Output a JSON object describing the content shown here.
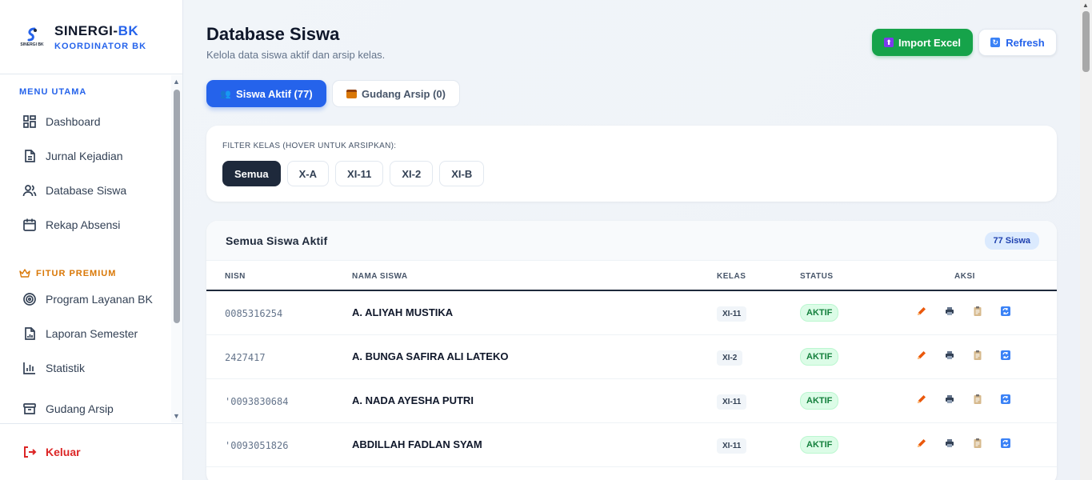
{
  "brand": {
    "name_main": "SINERGI-",
    "name_accent": "BK",
    "subtitle": "KOORDINATOR BK",
    "logo_text": "SINERGI BK"
  },
  "sidebar": {
    "menu_title": "MENU UTAMA",
    "menu_items": [
      {
        "label": "Dashboard",
        "icon": "dashboard-icon"
      },
      {
        "label": "Jurnal Kejadian",
        "icon": "document-icon"
      },
      {
        "label": "Database Siswa",
        "icon": "users-icon"
      },
      {
        "label": "Rekap Absensi",
        "icon": "calendar-icon"
      }
    ],
    "premium_title": "FITUR PREMIUM",
    "premium_items": [
      {
        "label": "Program Layanan BK",
        "icon": "target-icon"
      },
      {
        "label": "Laporan Semester",
        "icon": "report-icon"
      },
      {
        "label": "Statistik",
        "icon": "chart-icon"
      },
      {
        "label": "Gudang Arsip",
        "icon": "archive-icon"
      }
    ],
    "logout_label": "Keluar"
  },
  "header": {
    "title": "Database Siswa",
    "subtitle": "Kelola data siswa aktif dan arsip kelas.",
    "import_label": "Import Excel",
    "refresh_label": "Refresh"
  },
  "tabs": {
    "active_label": "Siswa Aktif (77)",
    "archive_label": "Gudang Arsip (0)"
  },
  "filter": {
    "label": "FILTER KELAS (HOVER UNTUK ARSIPKAN):",
    "chips": [
      "Semua",
      "X-A",
      "XI-11",
      "XI-2",
      "XI-B"
    ],
    "selected": "Semua"
  },
  "table": {
    "title": "Semua Siswa Aktif",
    "count_badge": "77 Siswa",
    "columns": {
      "nisn": "NISN",
      "nama": "NAMA SISWA",
      "kelas": "KELAS",
      "status": "STATUS",
      "aksi": "AKSI"
    },
    "rows": [
      {
        "nisn": "0085316254",
        "nama": "A. ALIYAH MUSTIKA",
        "kelas": "XI-11",
        "status": "AKTIF"
      },
      {
        "nisn": "2427417",
        "nama": "A. BUNGA SAFIRA ALI LATEKO",
        "kelas": "XI-2",
        "status": "AKTIF"
      },
      {
        "nisn": "'0093830684",
        "nama": "A. NADA AYESHA PUTRI",
        "kelas": "XI-11",
        "status": "AKTIF"
      },
      {
        "nisn": "'0093051826",
        "nama": "ABDILLAH FADLAN SYAM",
        "kelas": "XI-11",
        "status": "AKTIF"
      }
    ]
  },
  "colors": {
    "primary": "#2563eb",
    "success": "#16a34a",
    "premium": "#d97706",
    "danger": "#dc2626",
    "dark": "#1e293b"
  }
}
